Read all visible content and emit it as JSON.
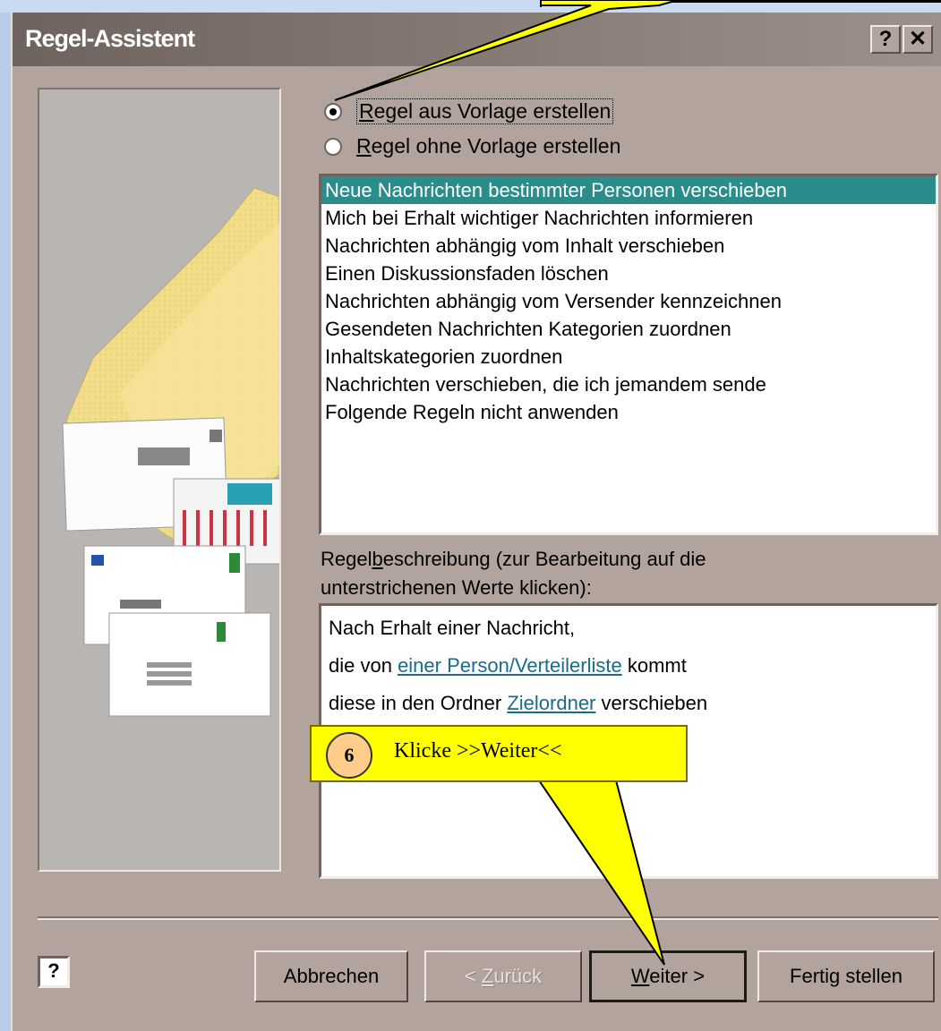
{
  "window": {
    "title": "Regel-Assistent",
    "help_button": "?",
    "close_button": "✕"
  },
  "options": {
    "from_template": "Regel aus Vorlage erstellen",
    "without_template": "Regel ohne Vorlage erstellen",
    "selected": "from_template"
  },
  "templates": {
    "items": [
      "Neue Nachrichten bestimmter Personen verschieben",
      "Mich bei Erhalt wichtiger Nachrichten informieren",
      "Nachrichten abhängig vom Inhalt verschieben",
      "Einen Diskussionsfaden löschen",
      "Nachrichten abhängig vom Versender kennzeichnen",
      "Gesendeten Nachrichten Kategorien zuordnen",
      "Inhaltskategorien zuordnen",
      "Nachrichten verschieben, die ich jemandem sende",
      "Folgende Regeln nicht anwenden"
    ],
    "selected_index": 0
  },
  "description": {
    "label_prefix": "Regel",
    "label_underlined": "b",
    "label_suffix": "eschreibung (zur Bearbeitung auf die",
    "label_line2": "unterstrichenen Werte klicken):",
    "line1": "Nach Erhalt einer Nachricht,",
    "line2_pre": "die von ",
    "line2_link": "einer Person/Verteilerliste",
    "line2_post": " kommt",
    "line3_pre": "diese in den Ordner ",
    "line3_link": "Zielordner",
    "line3_post": " verschieben"
  },
  "callout": {
    "step": "6",
    "text": "Klicke >>Weiter<<"
  },
  "buttons": {
    "help": "?",
    "cancel": "Abbrechen",
    "back_underlined": "Z",
    "back_pre": "< ",
    "back_post": "urück",
    "next_underlined": "W",
    "next_post": "eiter >",
    "finish": "Fertig stellen"
  },
  "colors": {
    "dialog_bg": "#b2a49d",
    "selection": "#2b8d8b",
    "callout": "#ffff00",
    "badge": "#ffcc8a",
    "link": "#1a6a8a"
  }
}
